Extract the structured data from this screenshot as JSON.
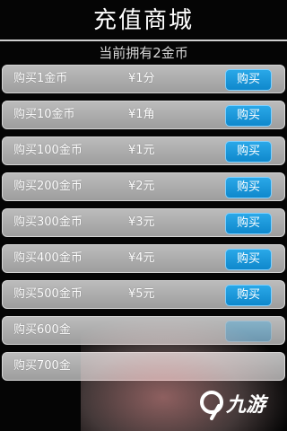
{
  "header": {
    "title": "充值商城",
    "balance_text": "当前拥有2金币"
  },
  "items": [
    {
      "name": "购买1金币",
      "price": "¥1分",
      "button": "购买"
    },
    {
      "name": "购买10金币",
      "price": "¥1角",
      "button": "购买"
    },
    {
      "name": "购买100金币",
      "price": "¥1元",
      "button": "购买"
    },
    {
      "name": "购买200金币",
      "price": "¥2元",
      "button": "购买"
    },
    {
      "name": "购买300金币",
      "price": "¥3元",
      "button": "购买"
    },
    {
      "name": "购买400金币",
      "price": "¥4元",
      "button": "购买"
    },
    {
      "name": "购买500金币",
      "price": "¥5元",
      "button": "购买"
    },
    {
      "name": "购买600金",
      "price": "",
      "button": ""
    },
    {
      "name": "购买700金",
      "price": "",
      "button": ""
    }
  ],
  "watermark": {
    "text": "九游",
    "icon": "9game-logo-icon"
  },
  "colors": {
    "background": "#050505",
    "row": "#a8a8a8",
    "button": "#1a96d8",
    "text": "#ffffff"
  }
}
